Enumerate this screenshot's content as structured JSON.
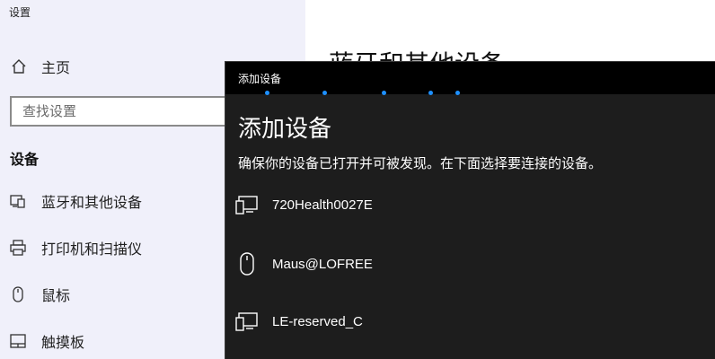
{
  "app": {
    "title": "设置"
  },
  "sidebar": {
    "home_label": "主页",
    "search_placeholder": "查找设置",
    "section_title": "设备",
    "items": [
      {
        "label": "蓝牙和其他设备",
        "icon": "bluetooth-devices-icon"
      },
      {
        "label": "打印机和扫描仪",
        "icon": "printer-icon"
      },
      {
        "label": "鼠标",
        "icon": "mouse-icon"
      },
      {
        "label": "触摸板",
        "icon": "touchpad-icon"
      }
    ]
  },
  "main": {
    "heading": "蓝牙和其他设备"
  },
  "dialog": {
    "titlebar": "添加设备",
    "heading": "添加设备",
    "description": "确保你的设备已打开并可被发现。在下面选择要连接的设备。",
    "devices": [
      {
        "name": "720Health0027E",
        "icon": "device-icon"
      },
      {
        "name": "Maus@LOFREE",
        "icon": "mouse-icon"
      },
      {
        "name": "LE-reserved_C",
        "icon": "device-icon"
      }
    ]
  },
  "colors": {
    "sidebar_bg": "#f0f0fa",
    "dialog_bg": "#1d1d1d",
    "accent": "#1e90ff"
  }
}
